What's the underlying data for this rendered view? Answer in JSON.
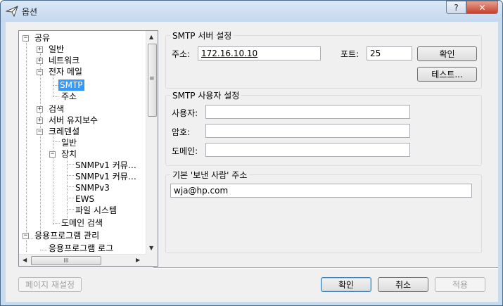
{
  "window": {
    "title": "옵션",
    "help_label": "?",
    "close_label": "✕"
  },
  "tree": {
    "items": [
      {
        "label": "공유",
        "expander": "−"
      },
      {
        "label": "일반",
        "expander": "+"
      },
      {
        "label": "네트워크",
        "expander": "+"
      },
      {
        "label": "전자 메일",
        "expander": "−"
      },
      {
        "label": "SMTP",
        "expander": ""
      },
      {
        "label": "주소",
        "expander": ""
      },
      {
        "label": "검색",
        "expander": "+"
      },
      {
        "label": "서버 유지보수",
        "expander": "+"
      },
      {
        "label": "크레덴셜",
        "expander": "−"
      },
      {
        "label": "일반",
        "expander": ""
      },
      {
        "label": "장치",
        "expander": "−"
      },
      {
        "label": "SNMPv1 커뮤…",
        "expander": ""
      },
      {
        "label": "SNMPv1 커뮤…",
        "expander": ""
      },
      {
        "label": "SNMPv3",
        "expander": ""
      },
      {
        "label": "EWS",
        "expander": ""
      },
      {
        "label": "파일 시스템",
        "expander": ""
      },
      {
        "label": "도메인 검색",
        "expander": ""
      },
      {
        "label": "응용프로그램 관리",
        "expander": "−"
      },
      {
        "label": "응용프로그램 로그",
        "expander": ""
      }
    ],
    "selected": "SMTP",
    "scroll_grip": "≡",
    "hscroll_grip": "III"
  },
  "smtp_server": {
    "title": "SMTP 서버 설정",
    "address_label": "주소:",
    "address_value": "172.16.10.10",
    "port_label": "포트:",
    "port_value": "25",
    "ok_label": "확인",
    "test_label": "테스트..."
  },
  "smtp_user": {
    "title": "SMTP 사용자 설정",
    "user_label": "사용자:",
    "user_value": "",
    "password_label": "암호:",
    "password_value": "",
    "domain_label": "도메인:",
    "domain_value": ""
  },
  "default_sender": {
    "title": "기본 '보낸 사람' 주소",
    "value": "wja@hp.com"
  },
  "footer": {
    "reset_label": "페이지 재설정",
    "ok_label": "확인",
    "cancel_label": "취소",
    "apply_label": "적용"
  }
}
